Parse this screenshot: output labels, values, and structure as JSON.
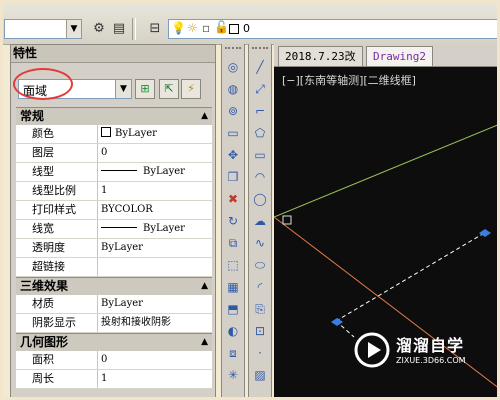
{
  "toolbar": {
    "layer_value": "0",
    "icons": [
      "gear-icon",
      "layer-states-icon",
      "bulb-icon",
      "sun-icon",
      "lock-icon",
      "color-square-icon"
    ]
  },
  "properties": {
    "title": "特性",
    "selection": "面域",
    "sections": [
      {
        "name": "常规",
        "rows": [
          {
            "key": "颜色",
            "value": "ByLayer",
            "swatch": true
          },
          {
            "key": "图层",
            "value": "0"
          },
          {
            "key": "线型",
            "value": "ByLayer",
            "line": true
          },
          {
            "key": "线型比例",
            "value": "1"
          },
          {
            "key": "打印样式",
            "value": "BYCOLOR"
          },
          {
            "key": "线宽",
            "value": "ByLayer",
            "line": true
          },
          {
            "key": "透明度",
            "value": "ByLayer"
          },
          {
            "key": "超链接",
            "value": ""
          }
        ]
      },
      {
        "name": "三维效果",
        "rows": [
          {
            "key": "材质",
            "value": "ByLayer"
          },
          {
            "key": "阴影显示",
            "value": "投射和接收阴影"
          }
        ]
      },
      {
        "name": "几何图形",
        "rows": [
          {
            "key": "面积",
            "value": "0"
          },
          {
            "key": "周长",
            "value": "1"
          }
        ]
      }
    ]
  },
  "drawing": {
    "tabs": [
      "2018.7.23改",
      "Drawing2"
    ],
    "viewport_label": "[−][东南等轴测][二维线框]"
  },
  "watermark": {
    "name": "溜溜自学",
    "url": "ZIXUE.3D66.COM"
  },
  "colors": {
    "x_axis": "#e07a4a",
    "y_axis": "#9bc25a",
    "grip": "#3a7de0",
    "highlight_ring": "#e53a3a"
  }
}
